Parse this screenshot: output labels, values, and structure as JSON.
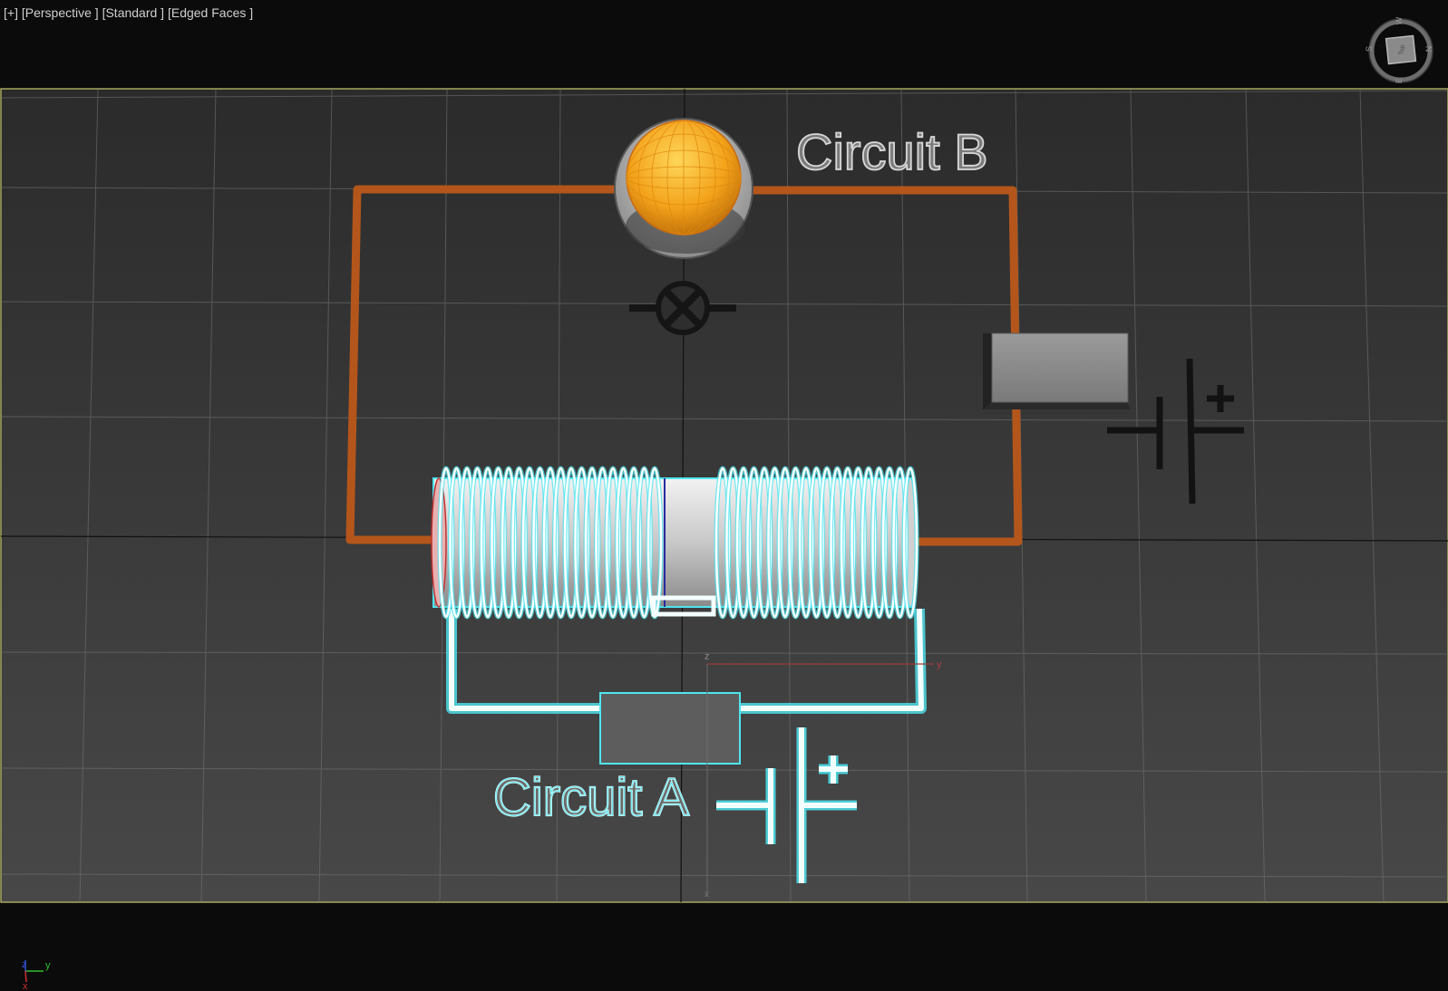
{
  "viewport": {
    "labels": [
      "[+]",
      "[Perspective ]",
      "[Standard ]",
      "[Edged Faces ]"
    ]
  },
  "viewcube": {
    "face": "Top",
    "compass": {
      "n": "N",
      "s": "S",
      "e": "E",
      "w": "W"
    }
  },
  "scene": {
    "circuit_b_label": "Circuit B",
    "circuit_a_label": "Circuit A",
    "battery_plus": "+",
    "circuit_b_wire_color": "#b4561b",
    "circuit_a_wire_color": "#e8ffff",
    "selection_color": "#4fe6f0",
    "bulb_color": "#f3a21a"
  },
  "gizmo": {
    "x": "x",
    "y": "y",
    "z": "z"
  },
  "axis_tripod": {
    "x": "x",
    "y": "y",
    "z": "z"
  },
  "colors": {
    "background": "#0b0b0b",
    "viewport_border": "#a8a860",
    "grid_line": "#7a7a7a",
    "axis_x": "#cc3030",
    "axis_y": "#30c030",
    "axis_z": "#3050d0"
  }
}
